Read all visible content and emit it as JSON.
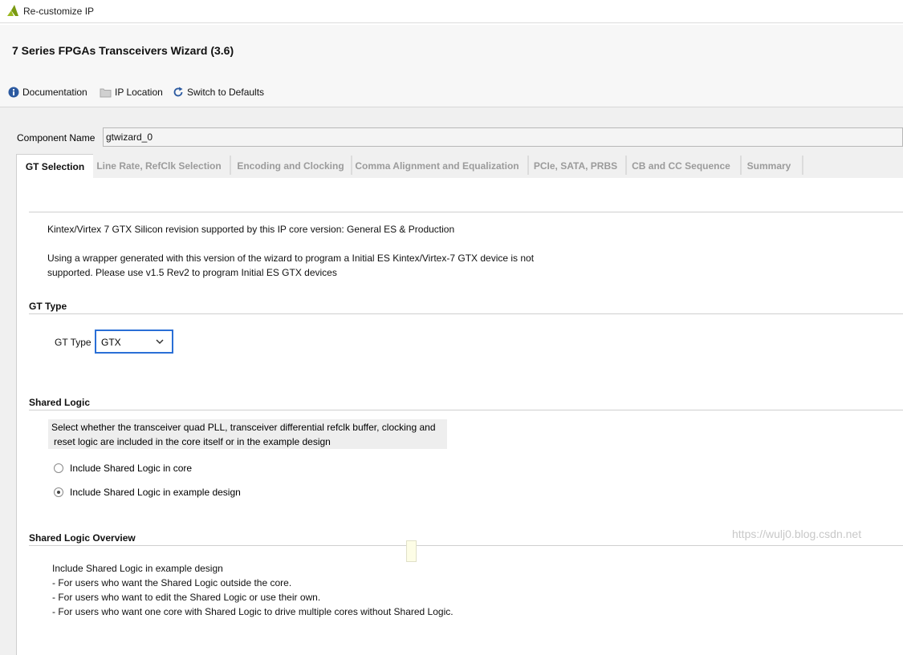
{
  "window": {
    "title": "Re-customize IP"
  },
  "wizard": {
    "title": "7 Series FPGAs Transceivers Wizard (3.6)"
  },
  "toolbar": {
    "documentation": "Documentation",
    "ip_location": "IP Location",
    "switch_defaults": "Switch to Defaults"
  },
  "component": {
    "label": "Component Name",
    "value": "gtwizard_0"
  },
  "tabs": [
    {
      "label": "GT Selection"
    },
    {
      "label": "Line Rate, RefClk Selection"
    },
    {
      "label": "Encoding and Clocking"
    },
    {
      "label": "Comma Alignment and Equalization"
    },
    {
      "label": "PCIe, SATA, PRBS"
    },
    {
      "label": "CB and CC Sequence"
    },
    {
      "label": "Summary"
    }
  ],
  "info": {
    "line1": "Kintex/Virtex 7 GTX Silicon revision supported by this IP core version: General ES & Production",
    "line2": "Using a wrapper generated with this version of the wizard to program a Initial ES Kintex/Virtex-7 GTX device is not",
    "line3": "supported. Please use v1.5 Rev2 to program Initial ES GTX devices"
  },
  "gt_type": {
    "section": "GT Type",
    "label": "GT Type",
    "value": "GTX"
  },
  "shared_logic": {
    "section": "Shared Logic",
    "desc1": "Select whether the transceiver quad PLL, transceiver differential refclk buffer, clocking and",
    "desc2": "reset logic are included in the core itself or in the example design",
    "options": [
      {
        "label": "Include Shared Logic in core",
        "selected": false
      },
      {
        "label": "Include Shared Logic in example design",
        "selected": true
      }
    ]
  },
  "overview": {
    "section": "Shared Logic Overview",
    "lines": [
      "Include Shared Logic in example design",
      "- For users who want the Shared Logic outside the core.",
      "- For users who want to edit the Shared Logic or use their own.",
      "- For users who want one core with Shared Logic to drive multiple cores without Shared Logic."
    ]
  },
  "watermark": "https://wulj0.blog.csdn.net",
  "colors": {
    "accent": "#2a6fd6",
    "info_icon": "#2c5aa0",
    "logo": "#9ab81e"
  }
}
